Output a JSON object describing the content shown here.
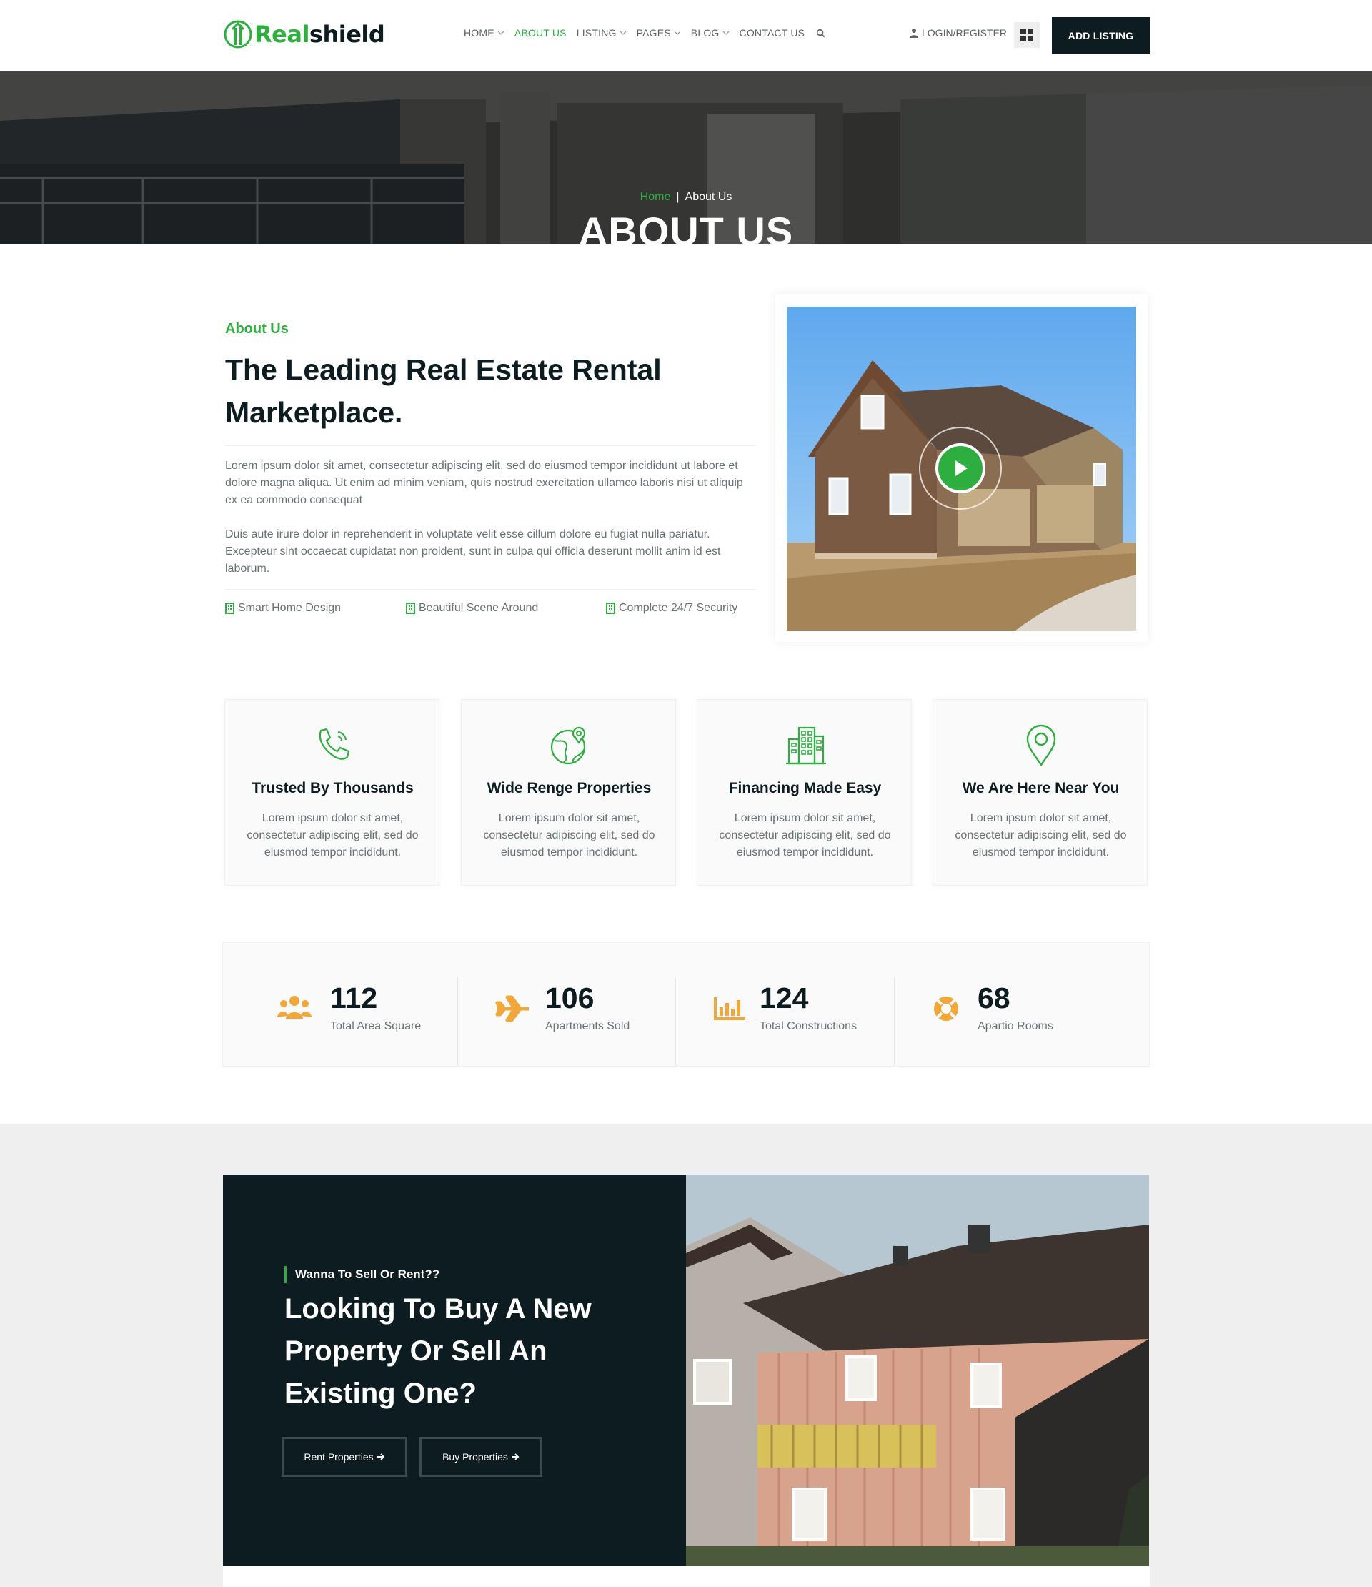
{
  "brand": {
    "logo_green": "Real",
    "logo_dark": "shield",
    "accent": "#2dae3f",
    "dark": "#0d1c20"
  },
  "nav": {
    "items": [
      {
        "label": "HOME",
        "dropdown": true
      },
      {
        "label": "ABOUT US",
        "dropdown": false,
        "active": true
      },
      {
        "label": "LISTING",
        "dropdown": true
      },
      {
        "label": "PAGES",
        "dropdown": true
      },
      {
        "label": "BLOG",
        "dropdown": true
      },
      {
        "label": "CONTACT US",
        "dropdown": false
      }
    ],
    "search_icon": "search-icon",
    "login_label": "LOGIN/REGISTER",
    "grid_icon": "grid-icon",
    "add_listing_label": "ADD LISTING"
  },
  "hero": {
    "breadcrumb_home": "Home",
    "breadcrumb_sep": "|",
    "breadcrumb_current": "About Us",
    "title": "ABOUT US"
  },
  "about": {
    "label": "About Us",
    "title": "The Leading Real Estate Rental Marketplace.",
    "paragraph1": "Lorem ipsum dolor sit amet, consectetur adipiscing elit, sed do eiusmod tempor incididunt ut labore et dolore magna aliqua. Ut enim ad minim veniam, quis nostrud exercitation ullamco laboris nisi ut aliquip ex ea commodo consequat",
    "paragraph2": "Duis aute irure dolor in reprehenderit in voluptate velit esse cillum dolore eu fugiat nulla pariatur. Excepteur sint occaecat cupidatat non proident, sunt in culpa qui officia deserunt mollit anim id est laborum.",
    "features": [
      "Smart Home Design",
      "Beautiful Scene Around",
      "Complete 24/7 Security"
    ]
  },
  "cards": [
    {
      "icon": "phone-icon",
      "title": "Trusted By Thousands",
      "desc": "Lorem ipsum dolor sit amet, consectetur adipiscing elit, sed do eiusmod tempor incididunt."
    },
    {
      "icon": "globe-icon",
      "title": "Wide Renge Properties",
      "desc": "Lorem ipsum dolor sit amet, consectetur adipiscing elit, sed do eiusmod tempor incididunt."
    },
    {
      "icon": "building-icon",
      "title": "Financing Made Easy",
      "desc": "Lorem ipsum dolor sit amet, consectetur adipiscing elit, sed do eiusmod tempor incididunt."
    },
    {
      "icon": "map-pin-icon",
      "title": "We Are Here Near You",
      "desc": "Lorem ipsum dolor sit amet, consectetur adipiscing elit, sed do eiusmod tempor incididunt."
    }
  ],
  "stats": [
    {
      "icon": "users-icon",
      "value": "112",
      "label": "Total Area Square"
    },
    {
      "icon": "plane-icon",
      "value": "106",
      "label": "Apartments Sold"
    },
    {
      "icon": "bar-chart-icon",
      "value": "124",
      "label": "Total Constructions"
    },
    {
      "icon": "life-ring-icon",
      "value": "68",
      "label": "Apartio Rooms"
    }
  ],
  "stats_color": "#f2a73b",
  "cta": {
    "subtitle": "Wanna To Sell Or Rent??",
    "title": "Looking To Buy A New Property Or Sell An Existing One?",
    "button_rent": "Rent Properties",
    "button_buy": "Buy Properties"
  }
}
